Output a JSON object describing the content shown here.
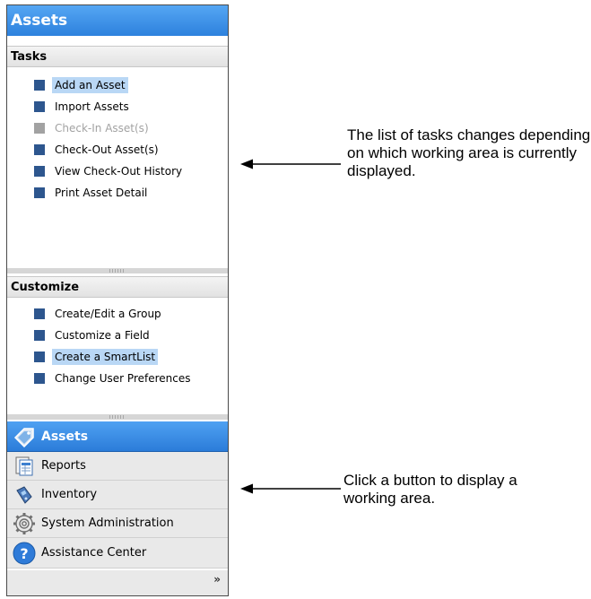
{
  "panel": {
    "title": "Assets",
    "tasks_header": "Tasks",
    "tasks": [
      {
        "label": "Add an Asset",
        "state": "selected"
      },
      {
        "label": "Import Assets",
        "state": "normal"
      },
      {
        "label": "Check-In Asset(s)",
        "state": "disabled"
      },
      {
        "label": "Check-Out Asset(s)",
        "state": "normal"
      },
      {
        "label": "View Check-Out History",
        "state": "normal"
      },
      {
        "label": "Print Asset Detail",
        "state": "normal"
      }
    ],
    "customize_header": "Customize",
    "customize": [
      {
        "label": "Create/Edit a Group",
        "state": "normal"
      },
      {
        "label": "Customize a Field",
        "state": "normal"
      },
      {
        "label": "Create a SmartList",
        "state": "selected"
      },
      {
        "label": "Change User Preferences",
        "state": "normal"
      }
    ],
    "nav_buttons": [
      {
        "label": "Assets",
        "icon": "assets-tag-icon",
        "active": true
      },
      {
        "label": "Reports",
        "icon": "reports-icon",
        "active": false
      },
      {
        "label": "Inventory",
        "icon": "inventory-scanner-icon",
        "active": false
      },
      {
        "label": "System Administration",
        "icon": "gear-icon",
        "active": false
      },
      {
        "label": "Assistance Center",
        "icon": "help-icon",
        "active": false
      }
    ],
    "overflow_glyph": "»"
  },
  "annotations": {
    "tasks_note": "The list of tasks changes depending on which working area is currently displayed.",
    "buttons_note": "Click a button to display a working area."
  },
  "colors": {
    "accent": "#2d81dd",
    "task_square": "#2d568e",
    "selected_highlight": "#b9d7f5"
  }
}
